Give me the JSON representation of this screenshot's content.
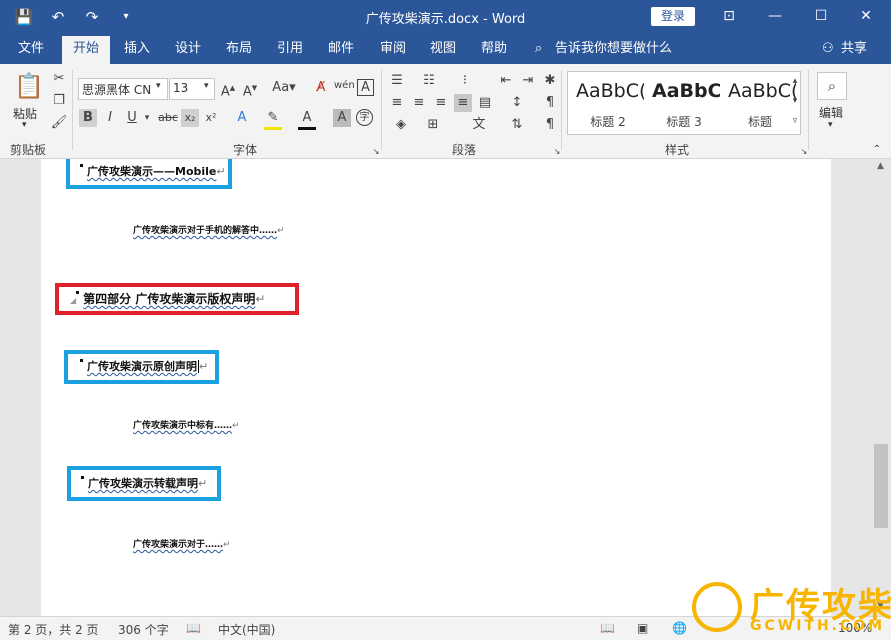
{
  "titlebar": {
    "title": "广传攻柴演示.docx  -  Word",
    "login": "登录",
    "icons": [
      "save-icon",
      "undo-icon",
      "redo-icon",
      "customize-icon"
    ]
  },
  "menu": {
    "tabs": [
      "文件",
      "开始",
      "插入",
      "设计",
      "布局",
      "引用",
      "邮件",
      "审阅",
      "视图",
      "帮助"
    ],
    "active": "开始",
    "search": "告诉我你想要做什么",
    "share": "共享"
  },
  "ribbon": {
    "paste": "粘贴",
    "clipboard": "剪贴板",
    "font_name": "思源黑体 CN",
    "font_size": "13",
    "font_group": "字体",
    "paragraph": "段落",
    "styles_group": "样式",
    "edit": "编辑",
    "styles": [
      {
        "sample": "AaBbC(",
        "name": "标题 2"
      },
      {
        "sample": "AaBbC(",
        "name": "标题 3"
      },
      {
        "sample": "AaBbC(",
        "name": "标题"
      }
    ]
  },
  "document": {
    "line1": "广传攻柴演示——Mobile",
    "line2": "广传攻柴演示对于手机的解答中……",
    "line3": "第四部分  广传攻柴演示版权声明",
    "line4": "广传攻柴演示原创声明",
    "line5": "广传攻柴演示中标有……",
    "line6": "广传攻柴演示转载声明",
    "line7": "广传攻柴演示对于……",
    "para_mark": "↵"
  },
  "status": {
    "page": "第 2 页，共 2 页",
    "words": "306 个字",
    "lang": "中文(中国)",
    "zoom": "100%"
  },
  "watermark": {
    "text": "广传攻柴",
    "sub": "GCWITH.COM"
  },
  "colors": {
    "accent": "#2b579a",
    "blue_box": "#1aa0e0",
    "red_box": "#e0202a",
    "watermark": "#f7b500"
  }
}
